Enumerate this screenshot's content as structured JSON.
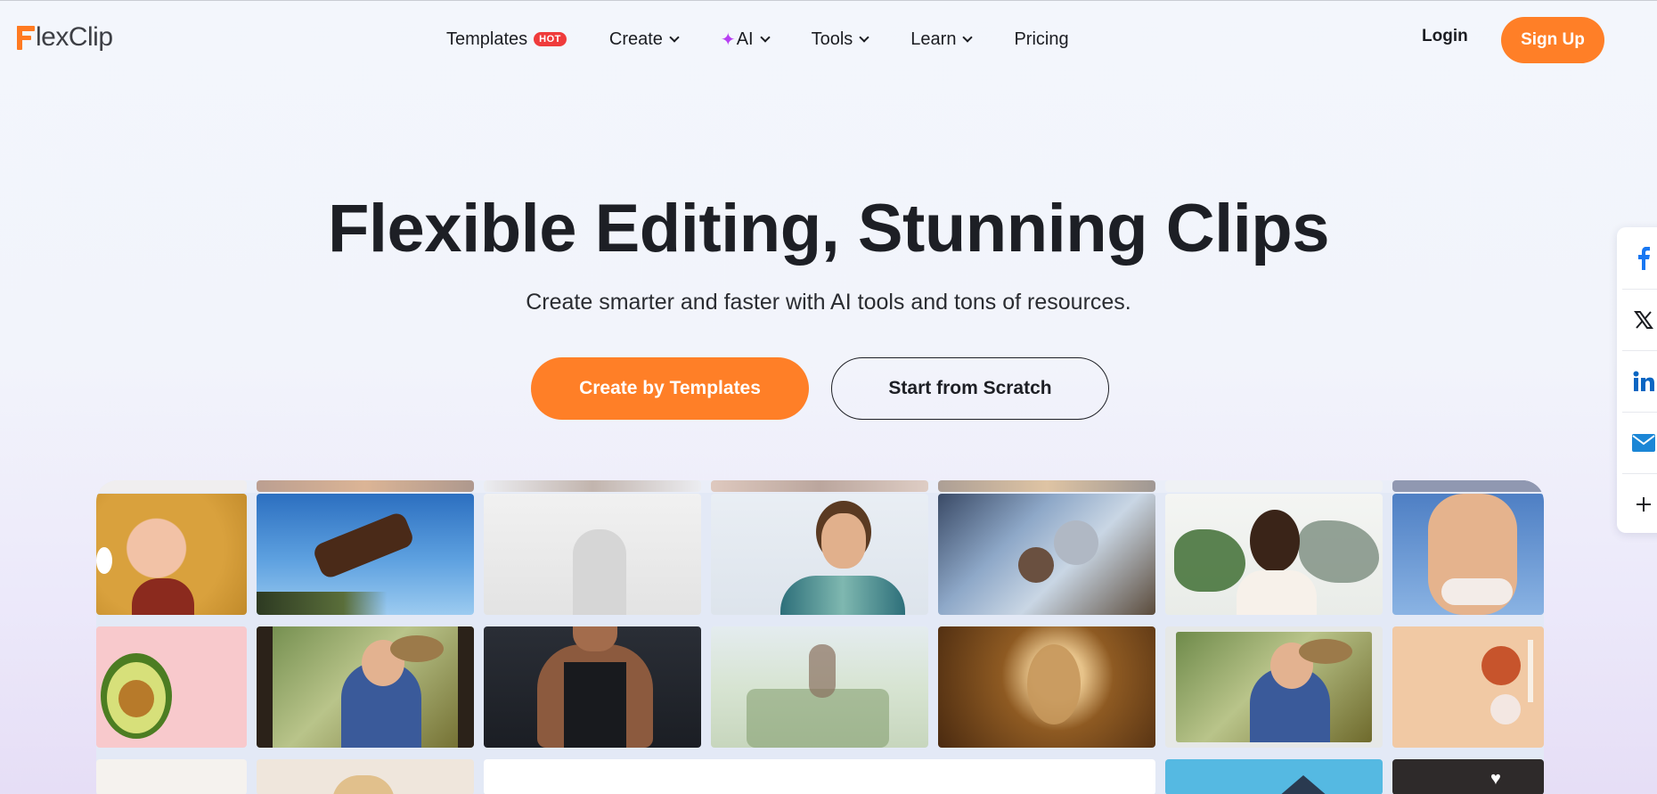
{
  "header": {
    "logo_text": "lexClip",
    "nav": [
      {
        "label": "Templates",
        "badge": "HOT"
      },
      {
        "label": "Create"
      },
      {
        "label": "AI"
      },
      {
        "label": "Tools"
      },
      {
        "label": "Learn"
      },
      {
        "label": "Pricing"
      }
    ],
    "login_label": "Login",
    "signup_label": "Sign Up"
  },
  "hero": {
    "title": "Flexible Editing, Stunning Clips",
    "subtitle": "Create smarter and faster with AI tools and tons of resources.",
    "primary_button": "Create by Templates",
    "secondary_button": "Start from Scratch"
  },
  "social": [
    "facebook-icon",
    "x-icon",
    "linkedin-icon",
    "email-icon",
    "plus-icon"
  ],
  "colors": {
    "accent": "#ff7f27",
    "hot_badge": "#ef3b3b",
    "ai_sparkle": "#b73ff2",
    "facebook": "#1877f2",
    "linkedin": "#0a66c2",
    "email": "#1b86d6"
  }
}
